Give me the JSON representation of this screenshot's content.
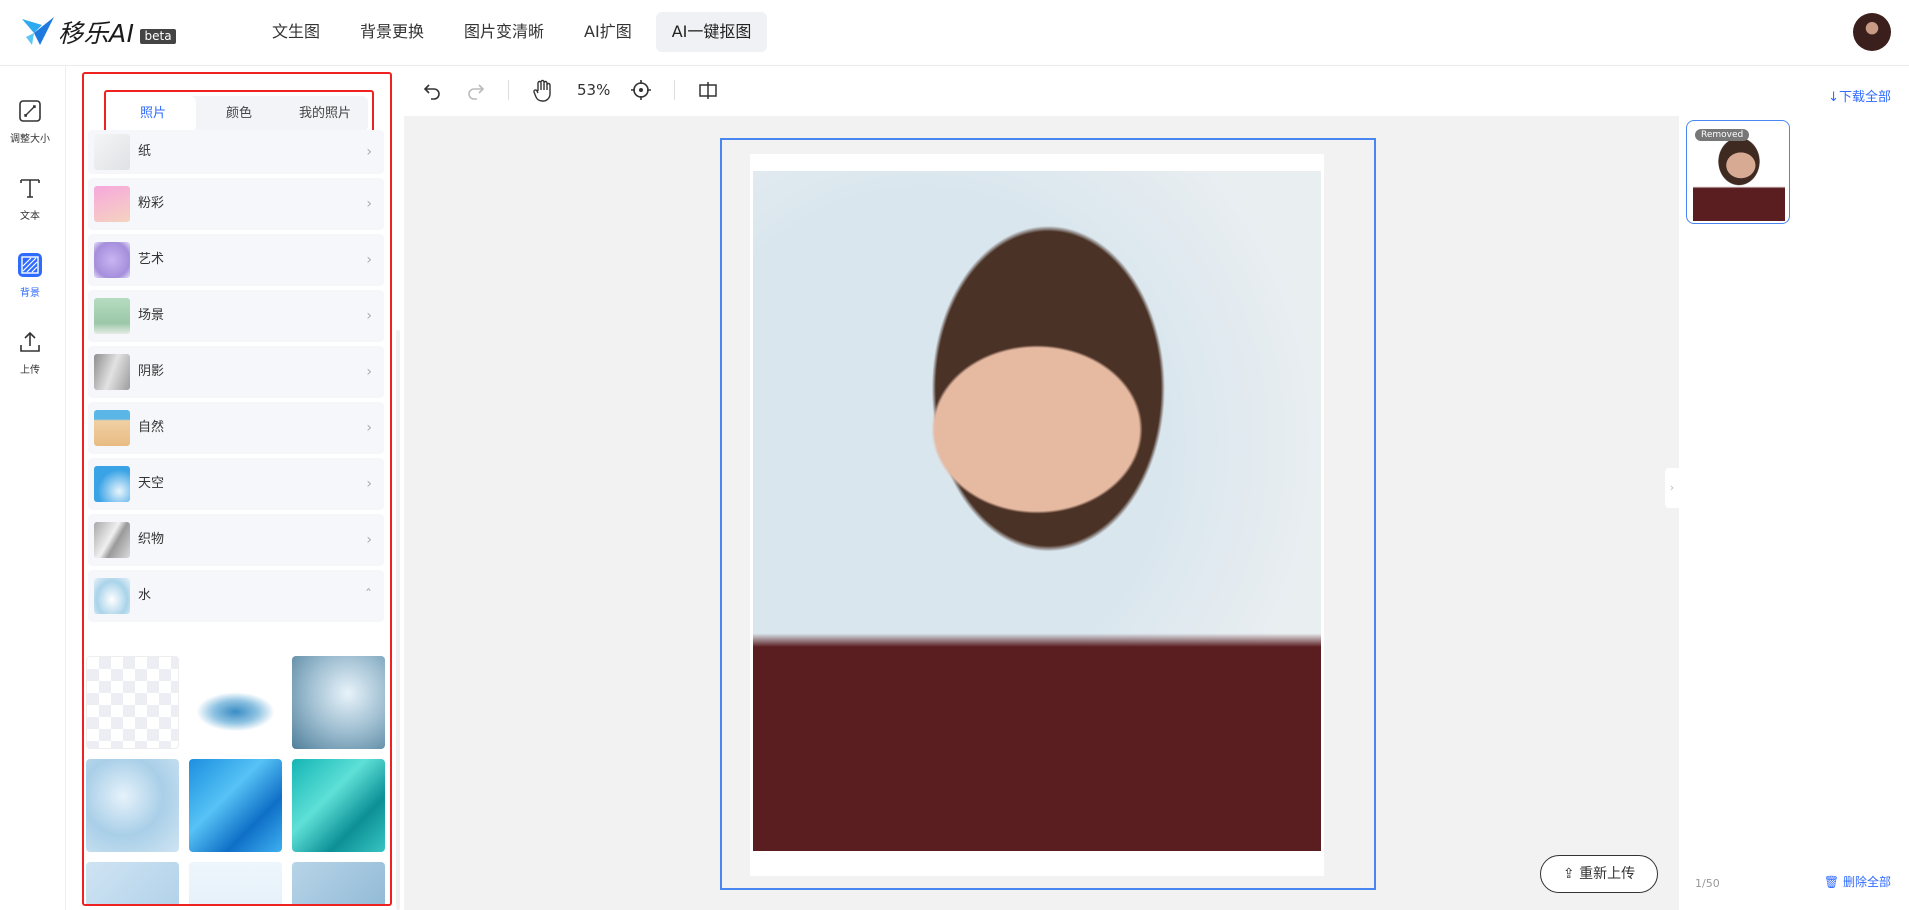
{
  "brand": {
    "name": "移乐AI",
    "badge": "beta",
    "accent": "#2f6bff"
  },
  "nav": {
    "items": [
      "文生图",
      "背景更换",
      "图片变清晰",
      "AI扩图",
      "AI一键抠图"
    ],
    "active_index": 4
  },
  "leftbar": {
    "tools": [
      {
        "label": "调整大小",
        "icon": "resize-icon"
      },
      {
        "label": "文本",
        "icon": "text-icon"
      },
      {
        "label": "背景",
        "icon": "background-icon"
      },
      {
        "label": "上传",
        "icon": "upload-icon"
      }
    ],
    "active_index": 2
  },
  "panel": {
    "tabs": [
      "照片",
      "颜色",
      "我的照片"
    ],
    "active_tab": 0,
    "categories": [
      {
        "name": "纸",
        "expanded": false,
        "color": "#e9ebee"
      },
      {
        "name": "粉彩",
        "expanded": false,
        "color": "#f1b6d8"
      },
      {
        "name": "艺术",
        "expanded": false,
        "color": "#b9a7e6"
      },
      {
        "name": "场景",
        "expanded": false,
        "color": "#a9d1b3"
      },
      {
        "name": "阴影",
        "expanded": false,
        "color": "#bdbdbd"
      },
      {
        "name": "自然",
        "expanded": false,
        "color": "#e8c08f"
      },
      {
        "name": "天空",
        "expanded": false,
        "color": "#4fa9e6"
      },
      {
        "name": "织物",
        "expanded": false,
        "color": "#c9c9c9"
      },
      {
        "name": "水",
        "expanded": true,
        "color": "#a9cde4"
      }
    ]
  },
  "toolbar": {
    "zoom": "53%"
  },
  "canvas": {
    "reupload_label": "重新上传"
  },
  "right": {
    "download_all": "下载全部",
    "badge": "Removed",
    "count": "1/50",
    "delete_all": "删除全部"
  }
}
